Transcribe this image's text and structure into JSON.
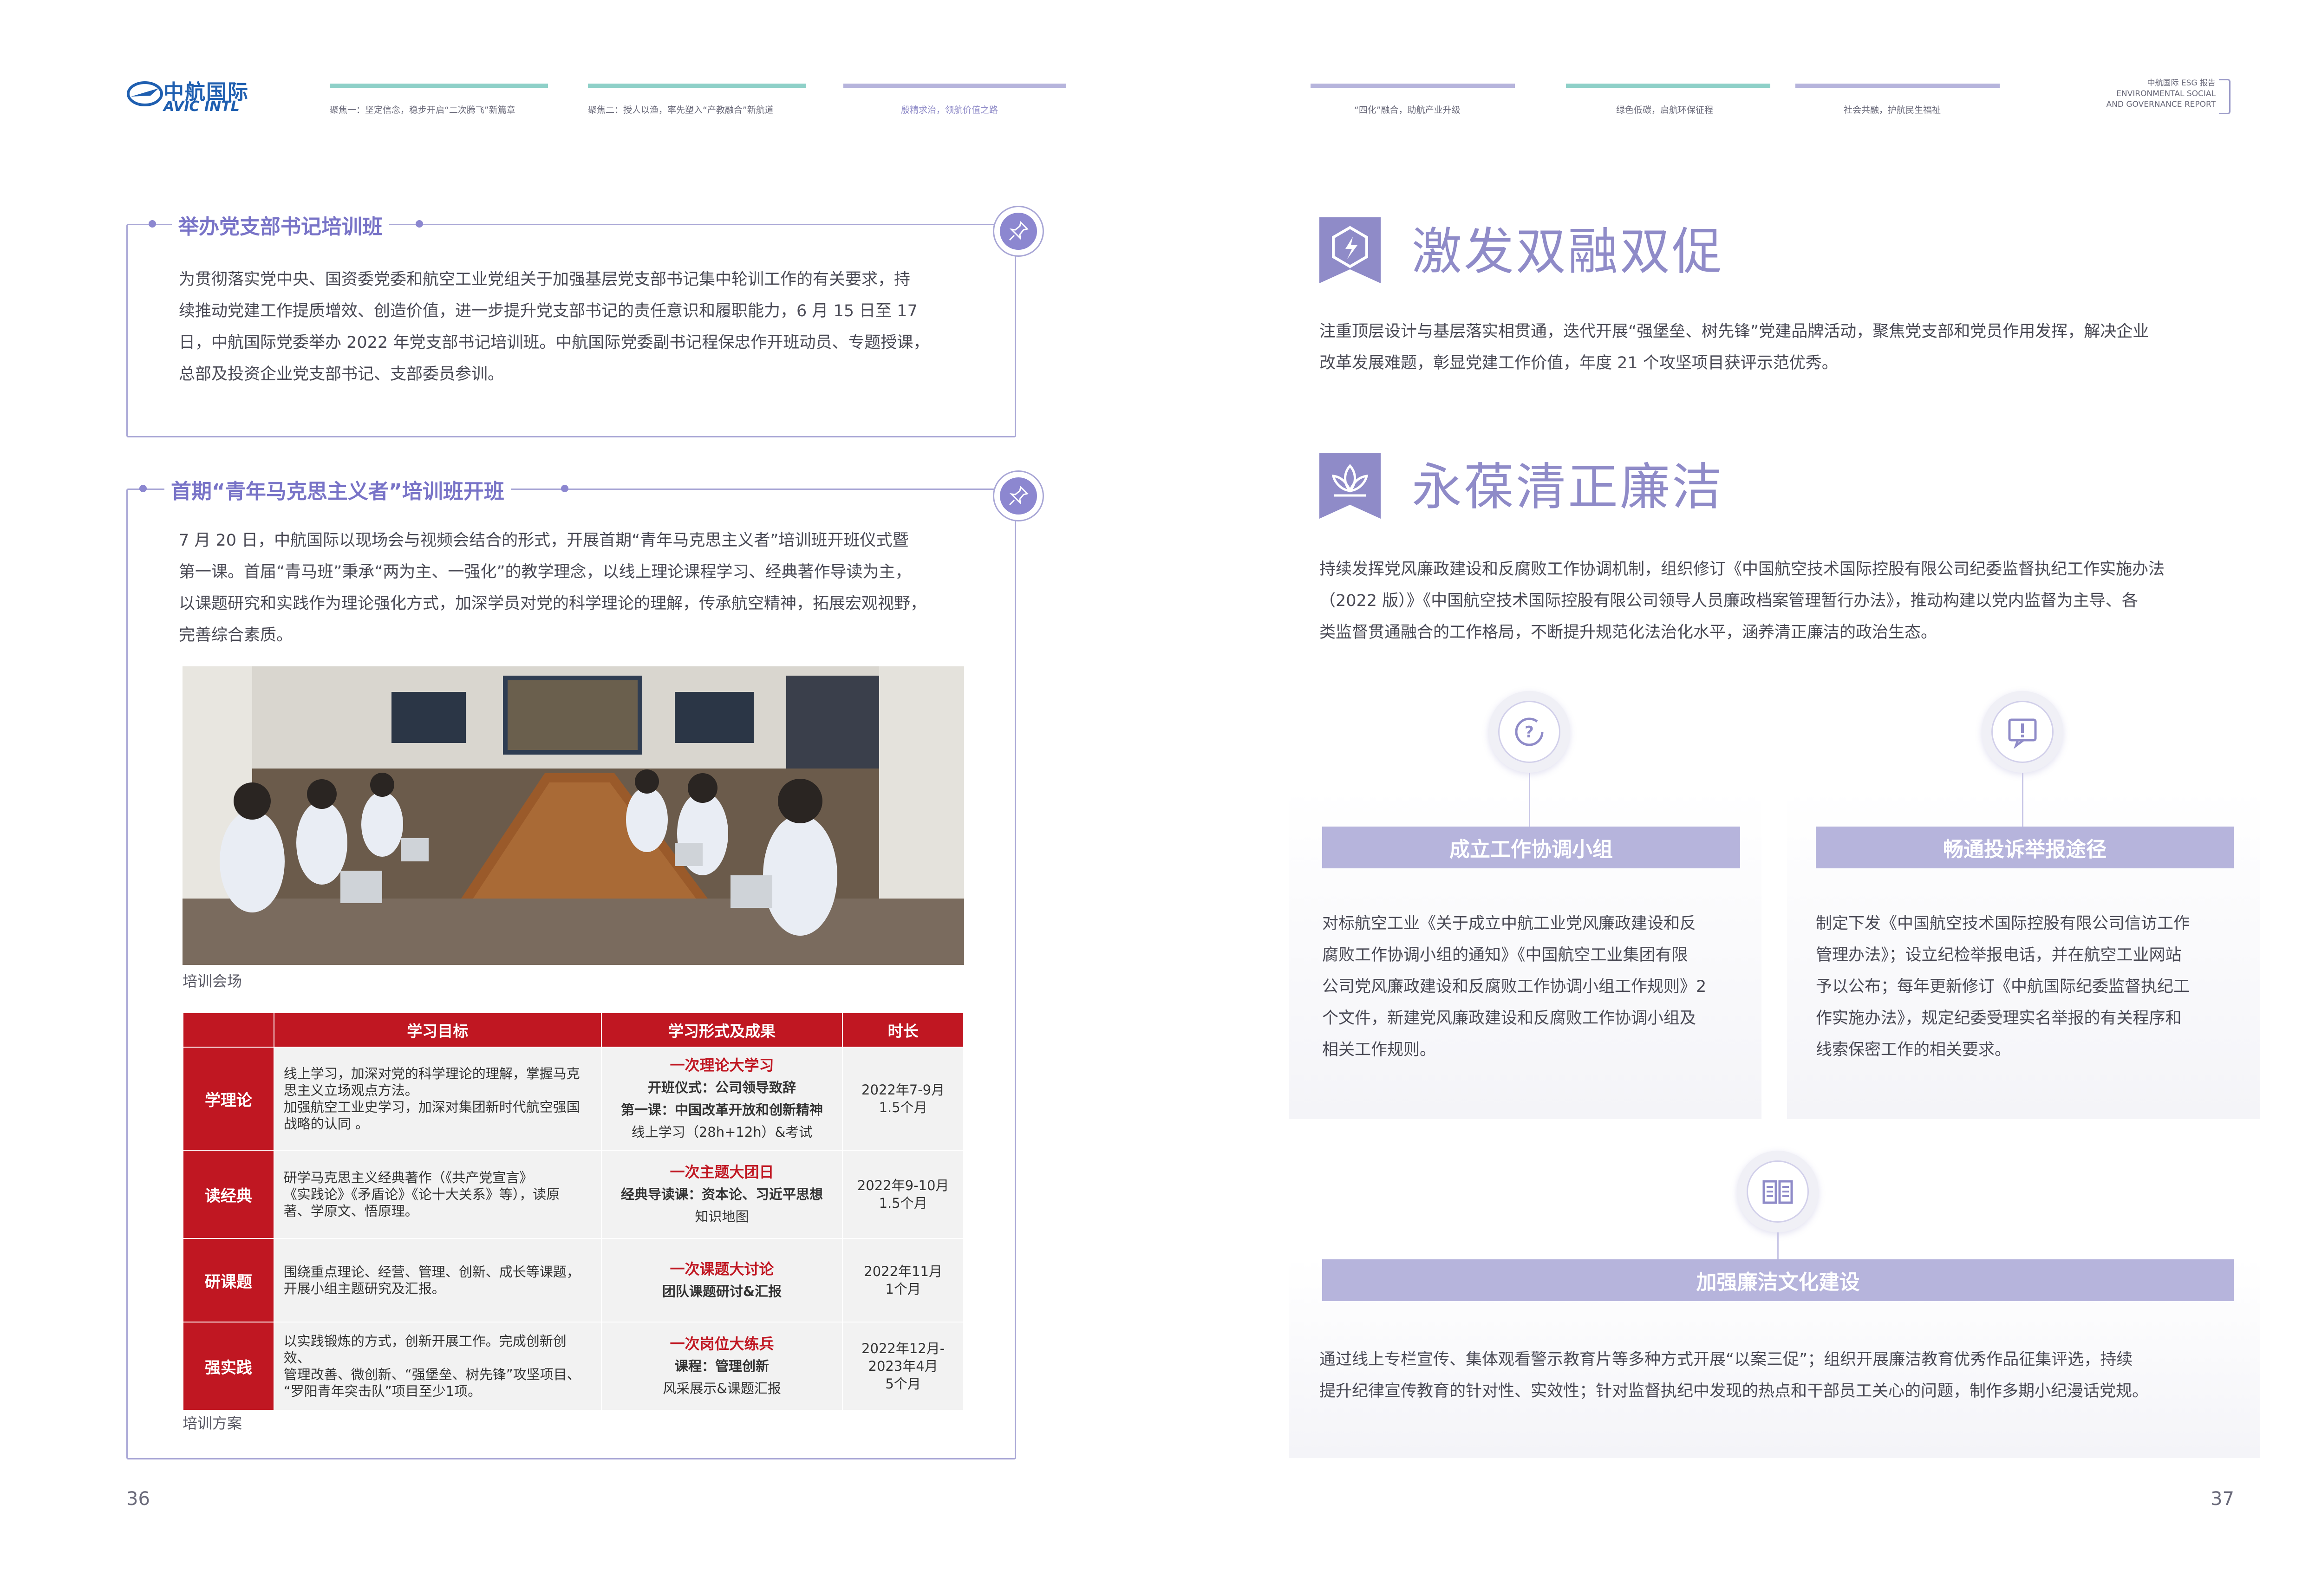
{
  "header": {
    "logo_cn": "中航国际",
    "logo_en": "AVIC INTL",
    "nav": [
      {
        "label": "聚焦一：坚定信念，稳步开启“二次腾飞”新篇章",
        "color": "#8ed0c8"
      },
      {
        "label": "聚焦二：授人以渔，率先塑入“产教融合”新航道",
        "color": "#8ed0c8"
      },
      {
        "label": "殷精求治，领航价值之路",
        "color": "#b6b4dc"
      },
      {
        "label": "“四化”融合，助航产业升级",
        "color": "#b6b4dc"
      },
      {
        "label": "绿色低碳，启航环保征程",
        "color": "#8ed0c8"
      },
      {
        "label": "社会共融，护航民生福祉",
        "color": "#b6b4dc"
      }
    ],
    "report_title_1": "中航国际 ESG 报告",
    "report_title_2": "ENVIRONMENTAL SOCIAL",
    "report_title_3": "AND GOVERNANCE REPORT"
  },
  "left": {
    "box1": {
      "title": "举办党支部书记培训班",
      "lines": [
        "为贯彻落实党中央、国资委党委和航空工业党组关于加强基层党支部书记集中轮训工作的有关要求，持",
        "续推动党建工作提质增效、创造价值，进一步提升党支部书记的责任意识和履职能力，6 月 15 日至 17",
        "日，中航国际党委举办 2022 年党支部书记培训班。中航国际党委副书记程保忠作开班动员、专题授课，",
        "总部及投资企业党支部书记、支部委员参训。"
      ]
    },
    "box2": {
      "title": "首期“青年马克思主义者”培训班开班",
      "lines": [
        "7 月 20 日，中航国际以现场会与视频会结合的形式，开展首期“青年马克思主义者”培训班开班仪式暨",
        "第一课。首届“青马班”秉承“两为主、一强化”的教学理念，以线上理论课程学习、经典著作导读为主，",
        "以课题研究和实践作为理论强化方式，加深学员对党的科学理论的理解，传承航空精神，拓展宏观视野，",
        "完善综合素质。"
      ],
      "photo_caption": "培训会场",
      "table_caption": "培训方案",
      "table": {
        "headers": [
          "学习目标",
          "学习形式及成果",
          "时长"
        ],
        "rows": [
          {
            "name": "学理论",
            "goal": [
              "线上学习，加深对党的科学理论的理解，掌握马克",
              "思主义立场观点方法。",
              "加强航空工业史学习，加深对集团新时代航空强国",
              "战略的认同 。"
            ],
            "form_title": "一次理论大学习",
            "form_lines": [
              "开班仪式：公司领导致辞",
              "第一课：中国改革开放和创新精神",
              "线上学习（28h+12h）&考试"
            ],
            "time": [
              "2022年7-9月",
              "1.5个月"
            ]
          },
          {
            "name": "读经典",
            "goal": [
              "研学马克思主义经典著作（《共产党宣言》",
              "《实践论》《矛盾论》《论十大关系》等），读原",
              "著、学原文、悟原理。"
            ],
            "form_title": "一次主题大团日",
            "form_lines": [
              "经典导读课：资本论、习近平思想",
              "知识地图"
            ],
            "time": [
              "2022年9-10月",
              "1.5个月"
            ]
          },
          {
            "name": "研课题",
            "goal": [
              "围绕重点理论、经营、管理、创新、成长等课题，",
              "开展小组主题研究及汇报。"
            ],
            "form_title": "一次课题大讨论",
            "form_lines": [
              "团队课题研讨&汇报"
            ],
            "time": [
              "2022年11月",
              "1个月"
            ]
          },
          {
            "name": "强实践",
            "goal": [
              "以实践锻炼的方式，创新开展工作。完成创新创效、",
              "管理改善、微创新、“强堡垒、树先锋”攻坚项目、",
              "“罗阳青年突击队”项目至少1项。"
            ],
            "form_title": "一次岗位大练兵",
            "form_lines": [
              "课程：管理创新",
              "风采展示&课题汇报"
            ],
            "time": [
              "2022年12月-",
              "2023年4月",
              "5个月"
            ]
          }
        ]
      }
    },
    "page_number": "36"
  },
  "right": {
    "section1": {
      "title": "激发双融双促",
      "lines": [
        "注重顶层设计与基层落实相贯通，迭代开展“强堡垒、树先锋”党建品牌活动，聚焦党支部和党员作用发挥，解决企业",
        "改革发展难题，彰显党建工作价值，年度 21 个攻坚项目获评示范优秀。"
      ]
    },
    "section2": {
      "title": "永葆清正廉洁",
      "lines": [
        "持续发挥党风廉政建设和反腐败工作协调机制，组织修订《中国航空技术国际控股有限公司纪委监督执纪工作实施办法",
        "（2022 版）》《中国航空技术国际控股有限公司领导人员廉政档案管理暂行办法》，推动构建以党内监督为主导、各",
        "类监督贯通融合的工作格局，不断提升规范化法治化水平，涵养清正廉洁的政治生态。"
      ]
    },
    "card1": {
      "title": "成立工作协调小组",
      "lines": [
        "对标航空工业《关于成立中航工业党风廉政建设和反",
        "腐败工作协调小组的通知》《中国航空工业集团有限",
        "公司党风廉政建设和反腐败工作协调小组工作规则》2",
        "个文件，新建党风廉政建设和反腐败工作协调小组及",
        "相关工作规则。"
      ]
    },
    "card2": {
      "title": "畅通投诉举报途径",
      "lines": [
        "制定下发《中国航空技术国际控股有限公司信访工作",
        "管理办法》；设立纪检举报电话，并在航空工业网站",
        "予以公布；每年更新修订《中航国际纪委监督执纪工",
        "作实施办法》，规定纪委受理实名举报的有关程序和",
        "线索保密工作的相关要求。"
      ]
    },
    "card3": {
      "title": "加强廉洁文化建设",
      "lines": [
        "通过线上专栏宣传、集体观看警示教育片等多种方式开展“以案三促”；组织开展廉洁教育优秀作品征集评选，持续",
        "提升纪律宣传教育的针对性、实效性；针对监督执纪中发现的热点和干部员工关心的问题，制作多期小纪漫话党规。"
      ]
    },
    "page_number": "37"
  }
}
